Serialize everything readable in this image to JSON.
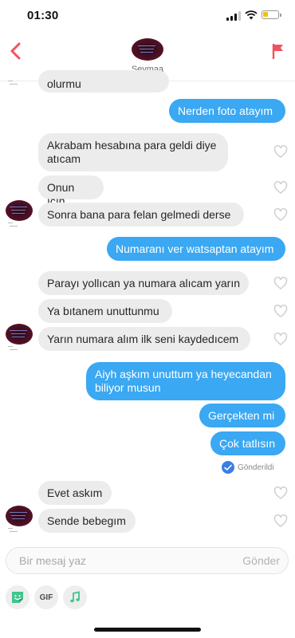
{
  "status": {
    "time": "01:30"
  },
  "header": {
    "contact_name": "Şeymaa",
    "back_icon": "chevron-left-icon",
    "report_icon": "flag-icon"
  },
  "messages": [
    {
      "side": "in",
      "text": "olurmu"
    },
    {
      "side": "out",
      "text": "Nerden foto atayım"
    },
    {
      "side": "in",
      "text": "Akrabam hesabına para geldi diye atıcam"
    },
    {
      "side": "in",
      "text": "Onun ıcın"
    },
    {
      "side": "in",
      "text": "Sonra bana para felan gelmedi derse"
    },
    {
      "side": "out",
      "text": "Numaranı ver watsaptan atayım"
    },
    {
      "side": "in",
      "text": "Parayı yollıcan ya numara alıcam yarın"
    },
    {
      "side": "in",
      "text": "Ya bıtanem unuttunmu"
    },
    {
      "side": "in",
      "text": "Yarın numara alım ilk seni kaydedıcem"
    },
    {
      "side": "out",
      "text": "Aiyh aşkım unuttum ya heyecandan biliyor musun"
    },
    {
      "side": "out",
      "text": "Gerçekten mi"
    },
    {
      "side": "out",
      "text": "Çok tatlısın"
    },
    {
      "side": "in",
      "text": "Evet askım"
    },
    {
      "side": "in",
      "text": "Sende bebegım"
    }
  ],
  "delivery": {
    "label": "Gönderildi"
  },
  "composer": {
    "placeholder": "Bir mesaj yaz",
    "send_label": "Gönder"
  },
  "toolbar": {
    "sticker_icon": "sticker-icon",
    "gif_label": "GIF",
    "music_icon": "music-note-icon"
  },
  "colors": {
    "accent_red": "#f0535f",
    "outgoing_bubble": "#3aa8f3",
    "incoming_bubble": "#ececec",
    "sticker_green": "#3fc48c"
  }
}
